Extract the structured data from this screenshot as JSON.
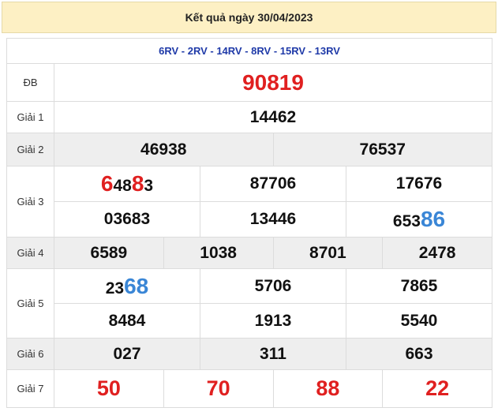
{
  "header": {
    "title": "Kết quả ngày 30/04/2023"
  },
  "codes": "6RV - 2RV - 14RV - 8RV - 15RV - 13RV",
  "labels": {
    "db": "ĐB",
    "g1": "Giải 1",
    "g2": "Giải 2",
    "g3": "Giải 3",
    "g4": "Giải 4",
    "g5": "Giải 5",
    "g6": "Giải 6",
    "g7": "Giải 7"
  },
  "prizes": {
    "db": "90819",
    "g1": "14462",
    "g2": [
      "46938",
      "76537"
    ],
    "g3": [
      {
        "parts": [
          "6",
          "48",
          "8",
          "3"
        ]
      },
      {
        "text": "87706"
      },
      {
        "text": "17676"
      },
      {
        "text": "03683"
      },
      {
        "text": "13446"
      },
      {
        "parts": [
          "653",
          "86"
        ]
      }
    ],
    "g4": [
      "6589",
      "1038",
      "8701",
      "2478"
    ],
    "g5": [
      {
        "parts": [
          "23",
          "68"
        ]
      },
      {
        "text": "5706"
      },
      {
        "text": "7865"
      },
      {
        "text": "8484"
      },
      {
        "text": "1913"
      },
      {
        "text": "5540"
      }
    ],
    "g6": [
      "027",
      "311",
      "663"
    ],
    "g7": [
      "50",
      "70",
      "88",
      "22"
    ]
  },
  "colors": {
    "special": "#e02020",
    "highlight_red": "#e02020",
    "highlight_blue": "#3a86d6",
    "codes": "#1f3aa8",
    "header_bg": "#fdf0c4"
  }
}
